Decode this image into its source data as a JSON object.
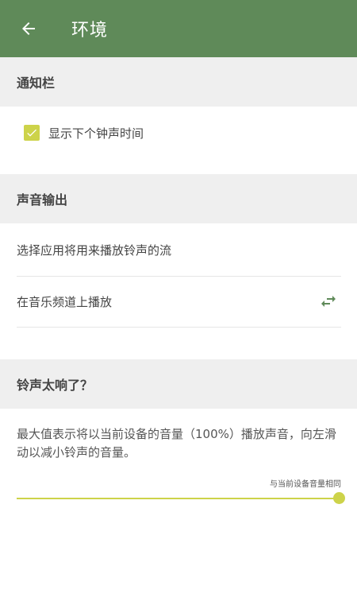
{
  "appbar": {
    "title": "环境",
    "back_icon": "arrow-left-icon"
  },
  "sections": {
    "notification": {
      "header": "通知栏",
      "show_next_ring_time": {
        "label": "显示下个钟声时间",
        "checked": true
      }
    },
    "audio_output": {
      "header": "声音输出",
      "select_stream_label": "选择应用将用来播放铃声的流",
      "play_on_music_channel_label": "在音乐频道上播放",
      "swap_icon": "swap-arrows-icon"
    },
    "too_loud": {
      "header": "铃声太响了？",
      "description": "最大值表示将以当前设备的音量（100%）播放声音，向左滑动以减小铃声的音量。",
      "slider_caption": "与当前设备音量相同",
      "slider_value_percent": 100
    }
  },
  "colors": {
    "appbar": "#5f8a59",
    "accent": "#cdd34a",
    "section_bg": "#efefef",
    "swap_icon": "#5f8a59"
  }
}
